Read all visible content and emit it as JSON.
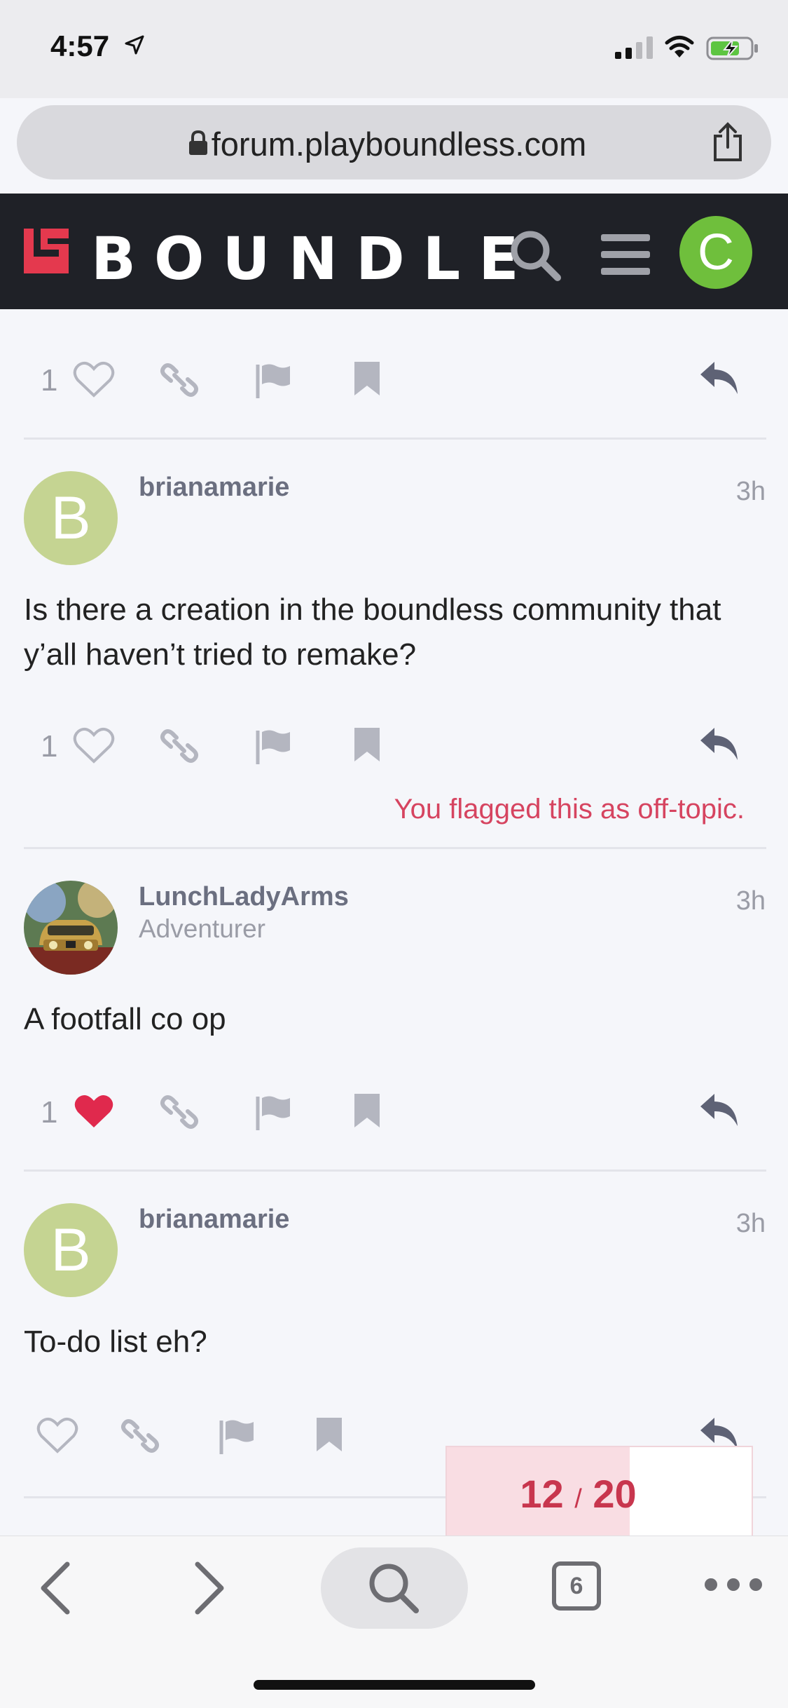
{
  "status_bar": {
    "time": "4:57"
  },
  "browser": {
    "url": "forum.playboundless.com",
    "tab_count": "6"
  },
  "site": {
    "logo": "BOUNDLE",
    "user_initial": "C"
  },
  "top_actions": {
    "like_count": "1"
  },
  "posts": [
    {
      "username": "brianamarie",
      "avatar_letter": "B",
      "time": "3h",
      "body": "Is there a creation in the boundless community that y’all haven’t tried to remake?",
      "like_count": "1",
      "flag_notice": "You flagged this as off-topic."
    },
    {
      "username": "LunchLadyArms",
      "user_title": "Adventurer",
      "time": "3h",
      "body": "A footfall co op",
      "like_count": "1"
    },
    {
      "username": "brianamarie",
      "avatar_letter": "B",
      "time": "3h",
      "body": "To-do list eh?"
    }
  ],
  "progress": {
    "current": "12",
    "separator": "/",
    "total": "20",
    "fraction": 0.6
  },
  "colors": {
    "accent": "#d64460",
    "header_bg": "#1f2127",
    "avatar_green": "#6fbf3c",
    "avatar_letter_bg": "#c5d492"
  }
}
